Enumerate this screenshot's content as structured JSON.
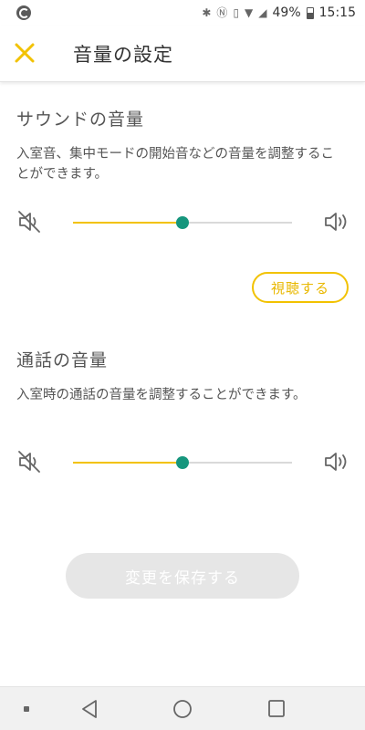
{
  "status_bar": {
    "battery": "49%",
    "time": "15:15"
  },
  "header": {
    "title": "音量の設定",
    "close_icon": "close-icon"
  },
  "sound_section": {
    "title": "サウンドの音量",
    "description": "入室音、集中モードの開始音などの音量を調整することができます。",
    "volume_level": 0.5,
    "preview_label": "視聴する"
  },
  "call_section": {
    "title": "通話の音量",
    "description": "入室時の通話の音量を調整することができます。",
    "volume_level": 0.5
  },
  "save_button": {
    "label": "変更を保存する"
  },
  "colors": {
    "accent_yellow": "#f2c200",
    "slider_thumb": "#16967d",
    "disabled_button": "#e6e6e6"
  }
}
